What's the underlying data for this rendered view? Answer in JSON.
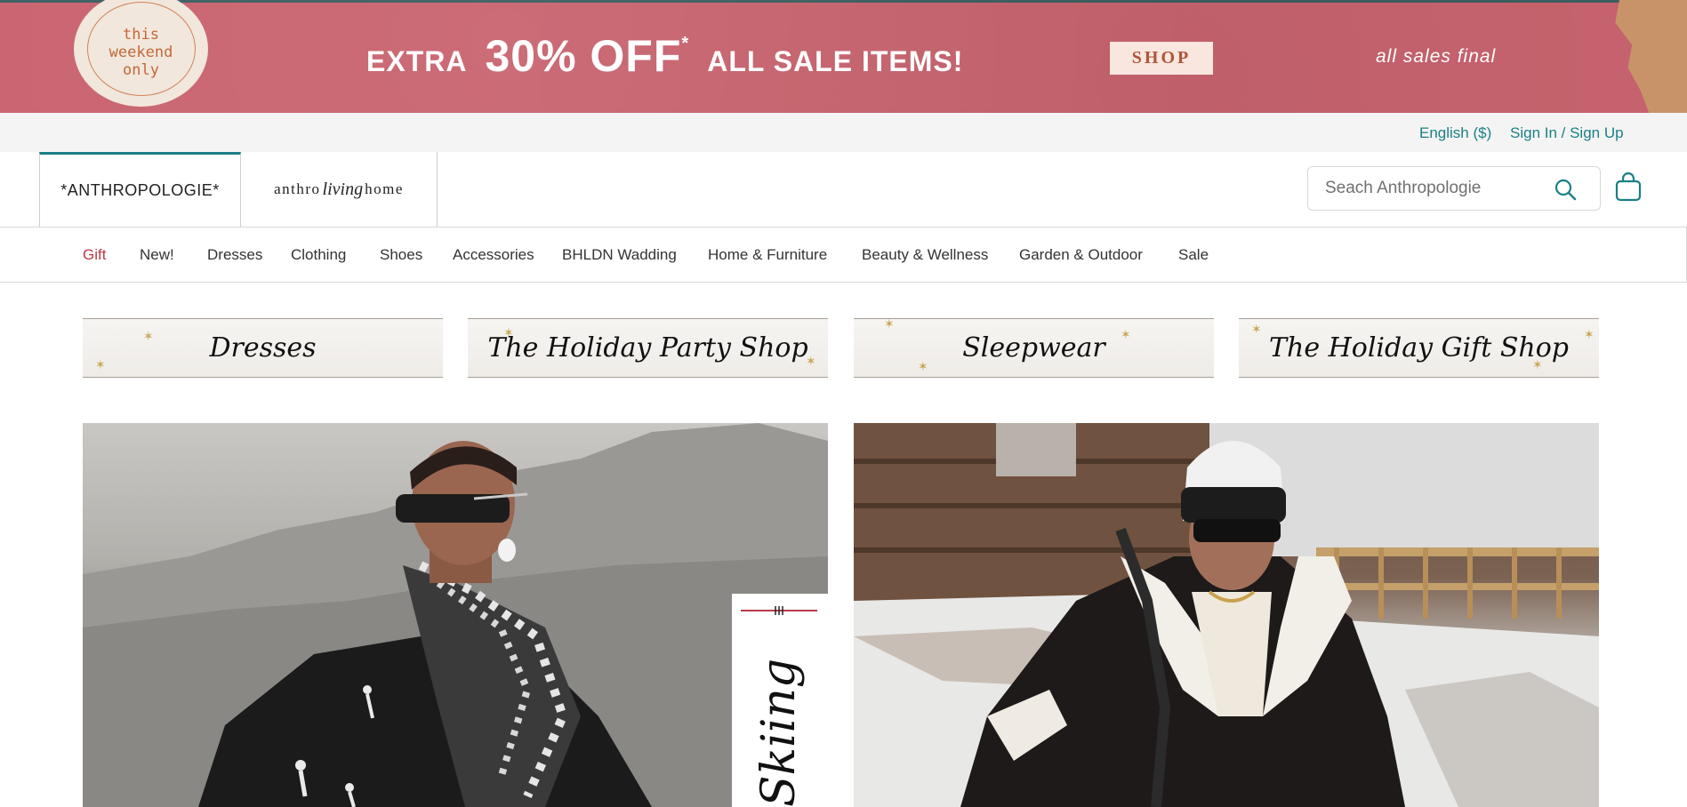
{
  "promo": {
    "stamp_text": "this\nweekend\nonly",
    "extra": "EXTRA",
    "percent": "30% OFF",
    "asterisk": "*",
    "items": "ALL SALE ITEMS!",
    "shop_label": "SHOP",
    "final_note": "all sales final",
    "colors": {
      "banner": "#c9646f",
      "shop_text": "#b0553b"
    }
  },
  "utility": {
    "language": "English ($)",
    "signin": "Sign In / Sign Up"
  },
  "header": {
    "brand_primary": "*ANTHROPOLOGIE*",
    "brand_secondary_left": "anthro",
    "brand_secondary_script": "living",
    "brand_secondary_right": "home",
    "search_placeholder": "Seach Anthropologie",
    "icons": {
      "search": "search-icon",
      "bag": "shopping-bag-icon"
    },
    "accent_color": "#1a7f86"
  },
  "nav": {
    "items": [
      "Gift",
      "New!",
      "Dresses",
      "Clothing",
      "Shoes",
      "Accessories",
      "BHLDN Wadding",
      "Home & Furniture",
      "Beauty & Wellness",
      "Garden & Outdoor",
      "Sale"
    ],
    "highlight_color": "#b83b46"
  },
  "categories": [
    "Dresses",
    "The Holiday Party Shop",
    "Sleepwear",
    "The Holiday Gift Shop"
  ],
  "hero": {
    "left_overlay_text": "Skiing"
  }
}
